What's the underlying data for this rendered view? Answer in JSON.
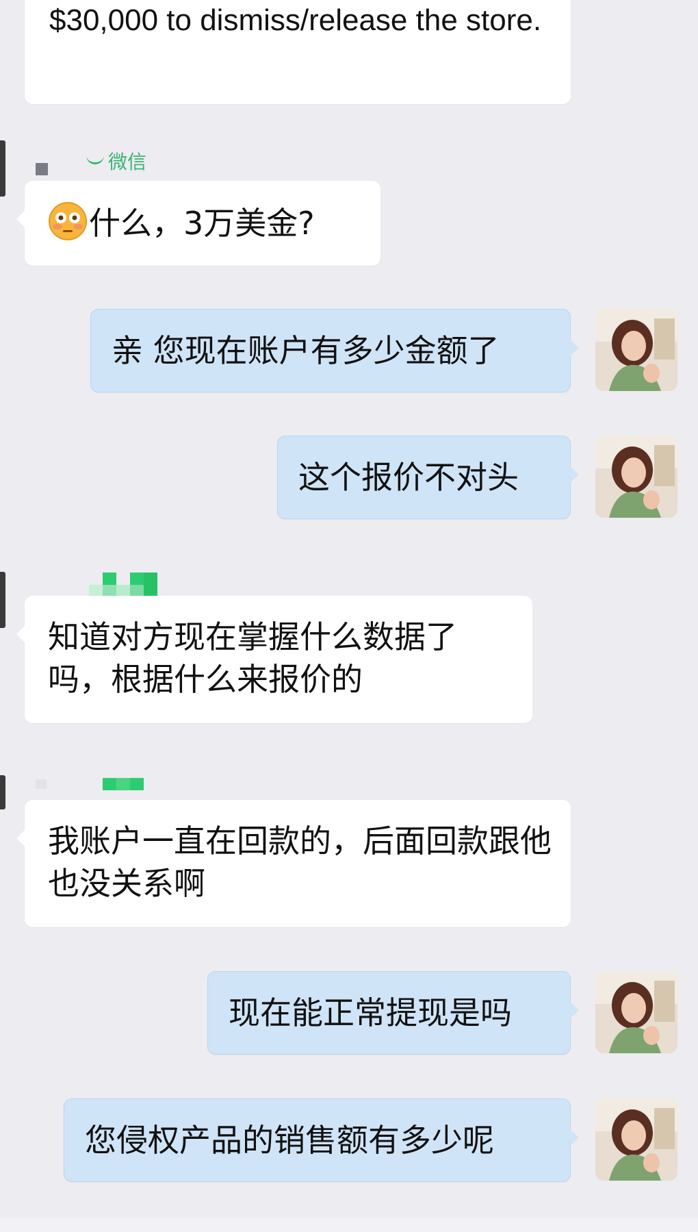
{
  "watermark_text": "微信",
  "messages": [
    {
      "id": "m1",
      "side": "incoming",
      "text": "$30,000 to dismiss/release the store."
    },
    {
      "id": "m2",
      "side": "incoming",
      "emoji": "flushed-face",
      "text": "什么，3万美金?"
    },
    {
      "id": "m3",
      "side": "outgoing",
      "text": "亲 您现在账户有多少金额了"
    },
    {
      "id": "m4",
      "side": "outgoing",
      "text": "这个报价不对头"
    },
    {
      "id": "m5",
      "side": "incoming",
      "text": "知道对方现在掌握什么数据了吗，根据什么来报价的"
    },
    {
      "id": "m6",
      "side": "incoming",
      "text": "我账户一直在回款的，后面回款跟他也没关系啊"
    },
    {
      "id": "m7",
      "side": "outgoing",
      "text": "现在能正常提现是吗"
    },
    {
      "id": "m8",
      "side": "outgoing",
      "text": "您侵权产品的销售额有多少呢"
    }
  ],
  "colors": {
    "background": "#ececf1",
    "incoming_bubble": "#ffffff",
    "outgoing_bubble": "#cfe4f7",
    "mosaic_green": "#2ecc71"
  }
}
